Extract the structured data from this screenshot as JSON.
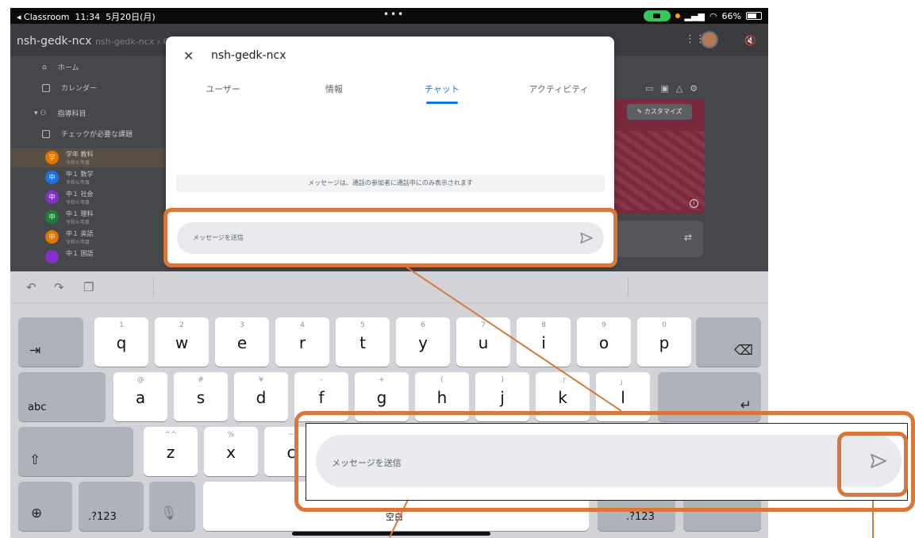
{
  "status_bar": {
    "back_app": "◂ Classroom",
    "time": "11:34",
    "date": "5月20日(月)",
    "dots": "•••",
    "battery": "66%"
  },
  "background_app": {
    "breadcrumb": "nsh-gedk-ncx",
    "breadcrumb_ghost": "nsh-gedk-ncx › Classroom",
    "nav": {
      "home": "ホーム",
      "calendar": "カレンダー",
      "teaching": "指導科目",
      "todo": "チェックが必要な課題"
    },
    "classes": [
      {
        "avatar": "学",
        "name": "学年 教科",
        "year": "令和６年度",
        "color": "#e37400",
        "selected": true
      },
      {
        "avatar": "中",
        "name": "中１ 数学",
        "year": "令和６年度",
        "color": "#1a73e8",
        "selected": false
      },
      {
        "avatar": "中",
        "name": "中１ 社会",
        "year": "令和６年度",
        "color": "#8430ce",
        "selected": false
      },
      {
        "avatar": "中",
        "name": "中１ 理科",
        "year": "令和６年度",
        "color": "#188038",
        "selected": false
      },
      {
        "avatar": "中",
        "name": "中１ 英語",
        "year": "令和６年度",
        "color": "#e37400",
        "selected": false
      },
      {
        "avatar": "",
        "name": "中１ 国語",
        "year": "",
        "color": "#8430ce",
        "selected": false
      }
    ],
    "customize_label": "カスタマイズ"
  },
  "dialog": {
    "title": "nsh-gedk-ncx",
    "tabs": [
      {
        "label": "ユーザー",
        "active": false
      },
      {
        "label": "情報",
        "active": false
      },
      {
        "label": "チャット",
        "active": true
      },
      {
        "label": "アクティビティ",
        "active": false
      }
    ],
    "system_message": "メッセージは、通話の参加者に通話中にのみ表示されます",
    "input_placeholder": "メッセージを送信"
  },
  "keyboard": {
    "row1": [
      {
        "main": "q",
        "sub": "1"
      },
      {
        "main": "w",
        "sub": "2"
      },
      {
        "main": "e",
        "sub": "3"
      },
      {
        "main": "r",
        "sub": "4"
      },
      {
        "main": "t",
        "sub": "5"
      },
      {
        "main": "y",
        "sub": "6"
      },
      {
        "main": "u",
        "sub": "7"
      },
      {
        "main": "i",
        "sub": "8"
      },
      {
        "main": "o",
        "sub": "9"
      },
      {
        "main": "p",
        "sub": "0"
      }
    ],
    "row2": [
      {
        "main": "a",
        "sub": "@"
      },
      {
        "main": "s",
        "sub": "#"
      },
      {
        "main": "d",
        "sub": "¥"
      },
      {
        "main": "f",
        "sub": "-"
      },
      {
        "main": "g",
        "sub": "+"
      },
      {
        "main": "h",
        "sub": "("
      },
      {
        "main": "j",
        "sub": ")"
      },
      {
        "main": "k",
        "sub": "「"
      },
      {
        "main": "l",
        "sub": "」"
      }
    ],
    "row3": [
      {
        "main": "z",
        "sub": "^^"
      },
      {
        "main": "x",
        "sub": "%"
      },
      {
        "main": "c",
        "sub": "~"
      }
    ],
    "abc_label": "abc",
    "num_label_left": ".?123",
    "num_label_right": ".?123",
    "space_label": "空白"
  },
  "zoom": {
    "input_placeholder": "メッセージを送信"
  },
  "colors": {
    "highlight": "#d9773a",
    "accent": "#1a73e8"
  }
}
